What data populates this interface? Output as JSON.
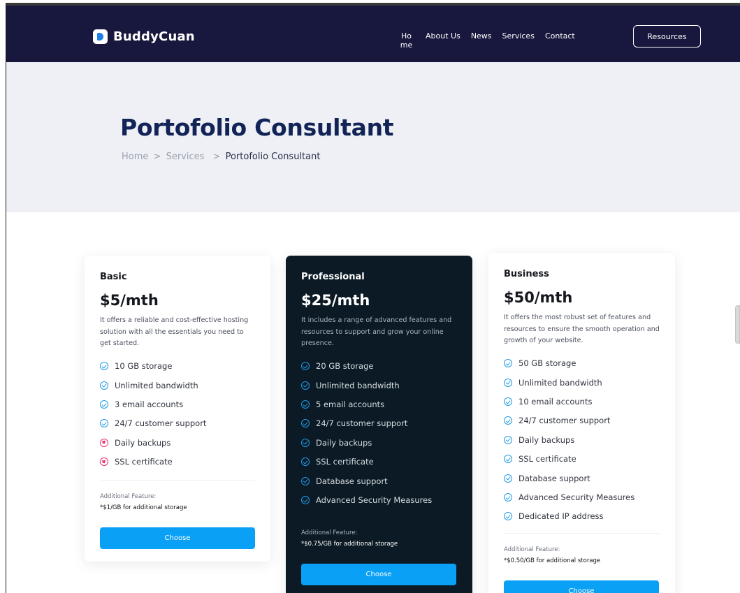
{
  "brand": {
    "name": "BuddyCuan"
  },
  "nav": {
    "items": [
      {
        "label": "Home"
      },
      {
        "label": "About Us"
      },
      {
        "label": "News"
      },
      {
        "label": "Services"
      },
      {
        "label": "Contact"
      }
    ],
    "resources_label": "Resources"
  },
  "hero": {
    "title": "Portofolio Consultant",
    "breadcrumb": {
      "home": "Home",
      "sep": ">",
      "services": "Services",
      "current": "Portofolio Consultant"
    }
  },
  "plans": [
    {
      "name": "Basic",
      "price": "$5/mth",
      "description": "It offers a reliable and cost-effective hosting solution with all the essentials you need to get started.",
      "features": [
        {
          "label": "10 GB storage",
          "included": true
        },
        {
          "label": "Unlimited bandwidth",
          "included": true
        },
        {
          "label": "3 email accounts",
          "included": true
        },
        {
          "label": "24/7 customer support",
          "included": true
        },
        {
          "label": "Daily backups",
          "included": false
        },
        {
          "label": "SSL certificate",
          "included": false
        }
      ],
      "additional_label": "Additional Feature:",
      "additional_note": "*$1/GB for additional storage",
      "button_label": "Choose"
    },
    {
      "name": "Professional",
      "price": "$25/mth",
      "description": "It includes a range of advanced features and resources to support and grow your online presence.",
      "features": [
        {
          "label": "20 GB storage",
          "included": true
        },
        {
          "label": "Unlimited bandwidth",
          "included": true
        },
        {
          "label": "5 email accounts",
          "included": true
        },
        {
          "label": "24/7 customer support",
          "included": true
        },
        {
          "label": "Daily backups",
          "included": true
        },
        {
          "label": "SSL certificate",
          "included": true
        },
        {
          "label": "Database support",
          "included": true
        },
        {
          "label": "Advanced Security Measures",
          "included": true
        }
      ],
      "additional_label": "Additional Feature:",
      "additional_note": "*$0.75/GB for additional storage",
      "button_label": "Choose"
    },
    {
      "name": "Business",
      "price": "$50/mth",
      "description": "It offers the most robust set of features and resources to ensure the smooth operation and growth of your website.",
      "features": [
        {
          "label": "50 GB storage",
          "included": true
        },
        {
          "label": "Unlimited bandwidth",
          "included": true
        },
        {
          "label": "10 email accounts",
          "included": true
        },
        {
          "label": "24/7 customer support",
          "included": true
        },
        {
          "label": "Daily backups",
          "included": true
        },
        {
          "label": "SSL certificate",
          "included": true
        },
        {
          "label": "Database support",
          "included": true
        },
        {
          "label": "Advanced Security Measures",
          "included": true
        },
        {
          "label": "Dedicated IP address",
          "included": true
        }
      ],
      "additional_label": "Additional Feature:",
      "additional_note": "*$0.50/GB for additional storage",
      "button_label": "Choose"
    }
  ],
  "colors": {
    "nav_bg": "#18173d",
    "hero_bg": "#eef0f6",
    "title": "#122356",
    "dark_card": "#0b1a25",
    "accent": "#0aa0f5",
    "check": "#1f9bea",
    "cross": "#e5326f"
  },
  "icons": {
    "included": "check-circle-icon",
    "excluded": "x-circle-icon",
    "logo": "buddycuan-logo-icon"
  }
}
